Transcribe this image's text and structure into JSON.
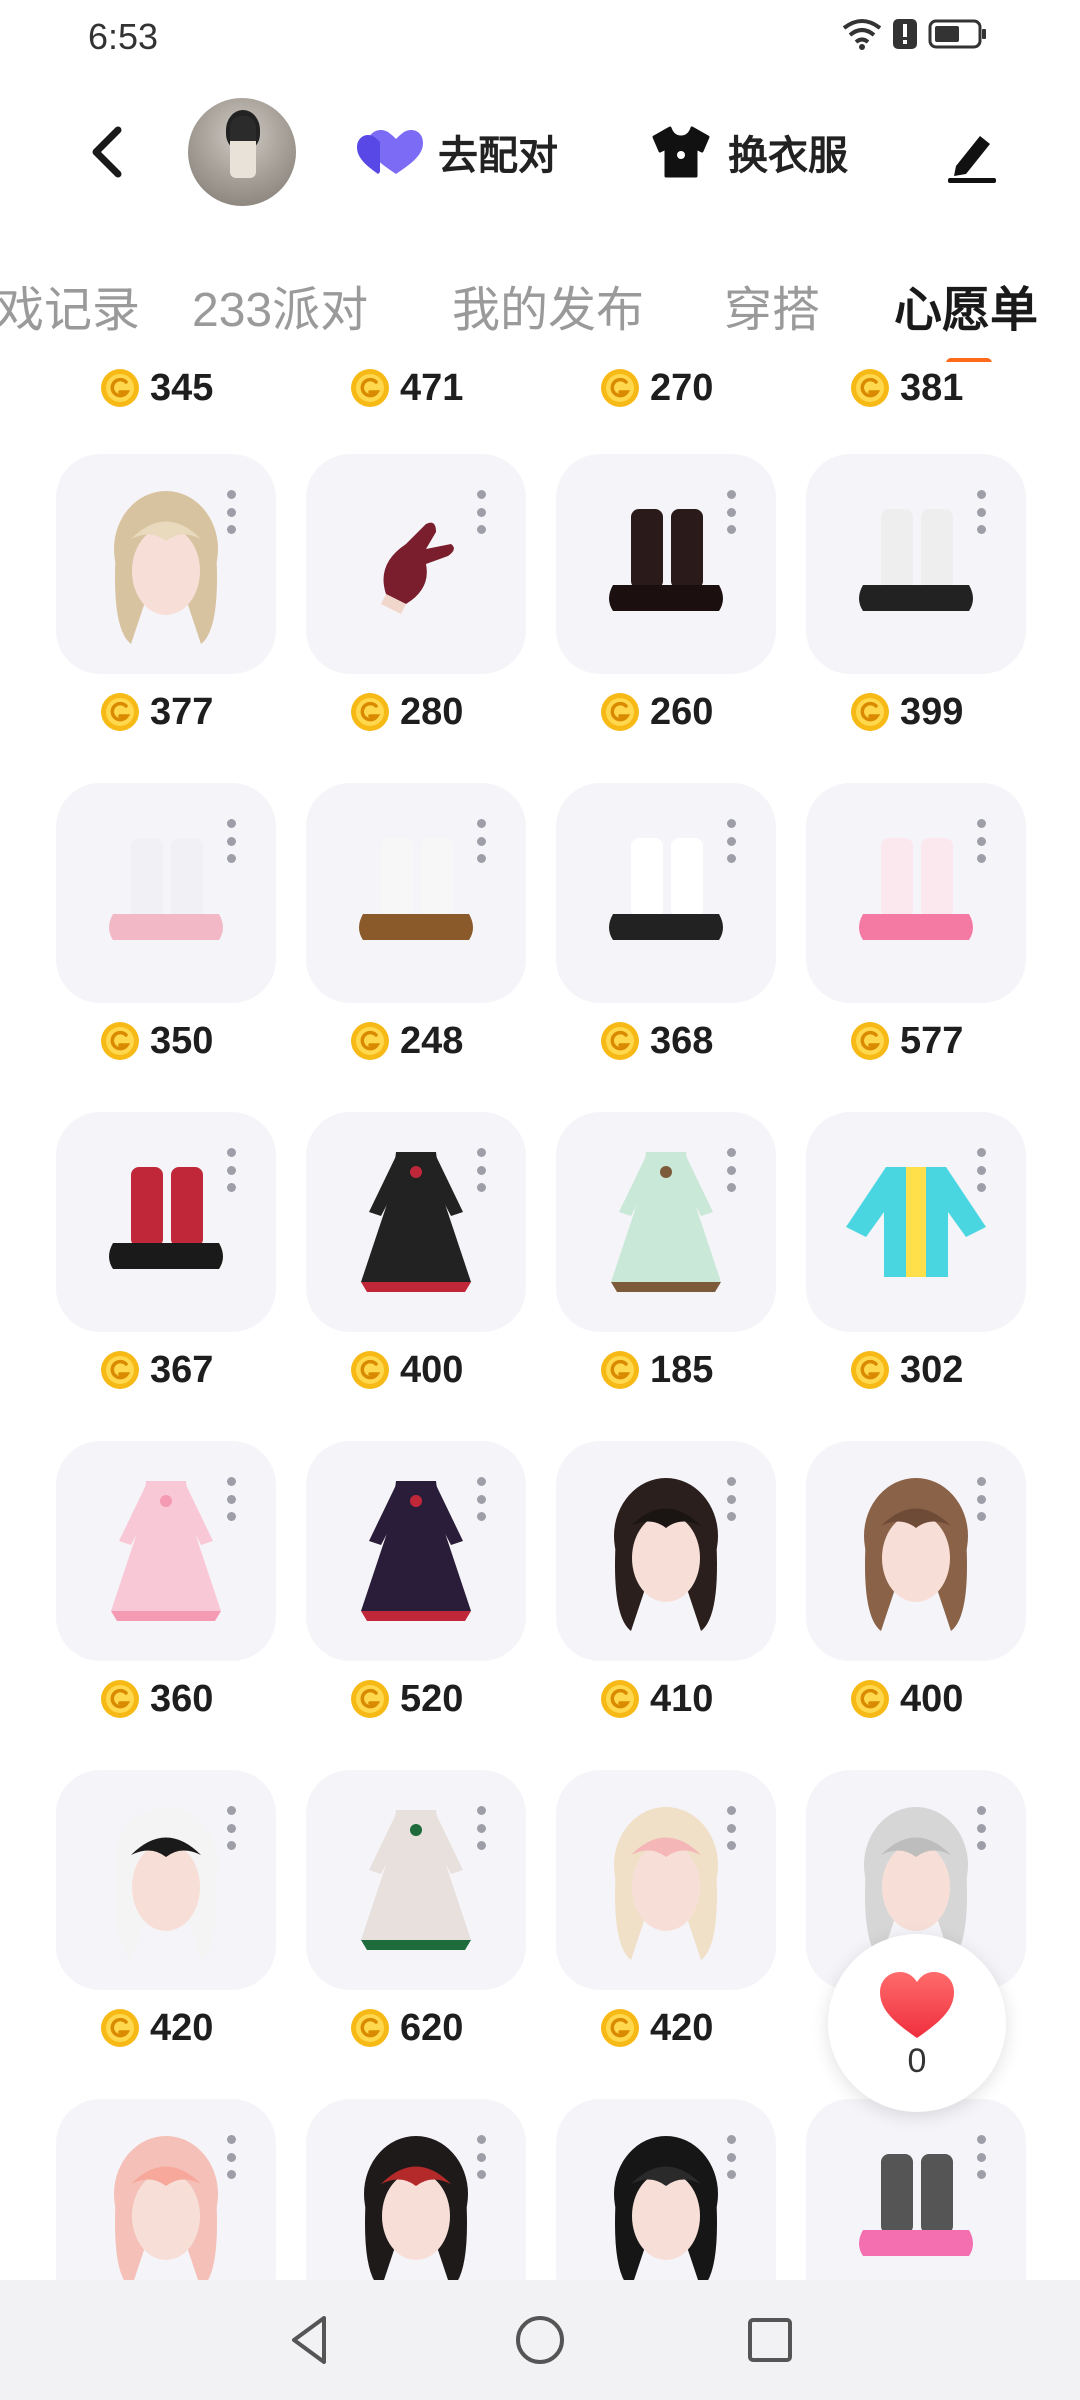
{
  "status_bar": {
    "time": "6:53"
  },
  "header": {
    "pair_label": "去配对",
    "dress_label": "换衣服"
  },
  "tabs": [
    "戏记录",
    "233派对",
    "我的发布",
    "穿搭",
    "心愿单"
  ],
  "top_prices": [
    "345",
    "471",
    "270",
    "381"
  ],
  "items": [
    {
      "name": "blonde-twin-tail-hair",
      "price": "377"
    },
    {
      "name": "red-gloves",
      "price": "280"
    },
    {
      "name": "black-red-heels",
      "price": "260"
    },
    {
      "name": "zebra-platform-boots",
      "price": "399"
    },
    {
      "name": "pastel-leg-warmer-boots",
      "price": "350"
    },
    {
      "name": "white-socks-clogs",
      "price": "248"
    },
    {
      "name": "white-platform-sneakers",
      "price": "368"
    },
    {
      "name": "pink-bow-leg-warmers",
      "price": "577"
    },
    {
      "name": "black-red-combat-boots",
      "price": "367"
    },
    {
      "name": "black-lace-skirt-set",
      "price": "400"
    },
    {
      "name": "mint-lolita-dress",
      "price": "185"
    },
    {
      "name": "neon-puffer-jacket",
      "price": "302"
    },
    {
      "name": "pink-floral-dress",
      "price": "360"
    },
    {
      "name": "dark-gothic-dress",
      "price": "520"
    },
    {
      "name": "black-bow-long-hair",
      "price": "410"
    },
    {
      "name": "brown-flower-hair",
      "price": "400"
    },
    {
      "name": "black-heart-veil-hair",
      "price": "420"
    },
    {
      "name": "christmas-dress",
      "price": "620"
    },
    {
      "name": "cream-heart-hair",
      "price": "420"
    },
    {
      "name": "silver-long-hair",
      "price": ""
    },
    {
      "name": "pink-wavy-hair",
      "price": ""
    },
    {
      "name": "black-ornament-hair",
      "price": ""
    },
    {
      "name": "black-bun-hair",
      "price": ""
    },
    {
      "name": "grey-socks-pink-shoes",
      "price": ""
    }
  ],
  "favorite": {
    "count": "0"
  },
  "colors": {
    "accent": "#ff6a1a",
    "coin": "#f6b915",
    "card_bg": "#f5f4f8"
  }
}
